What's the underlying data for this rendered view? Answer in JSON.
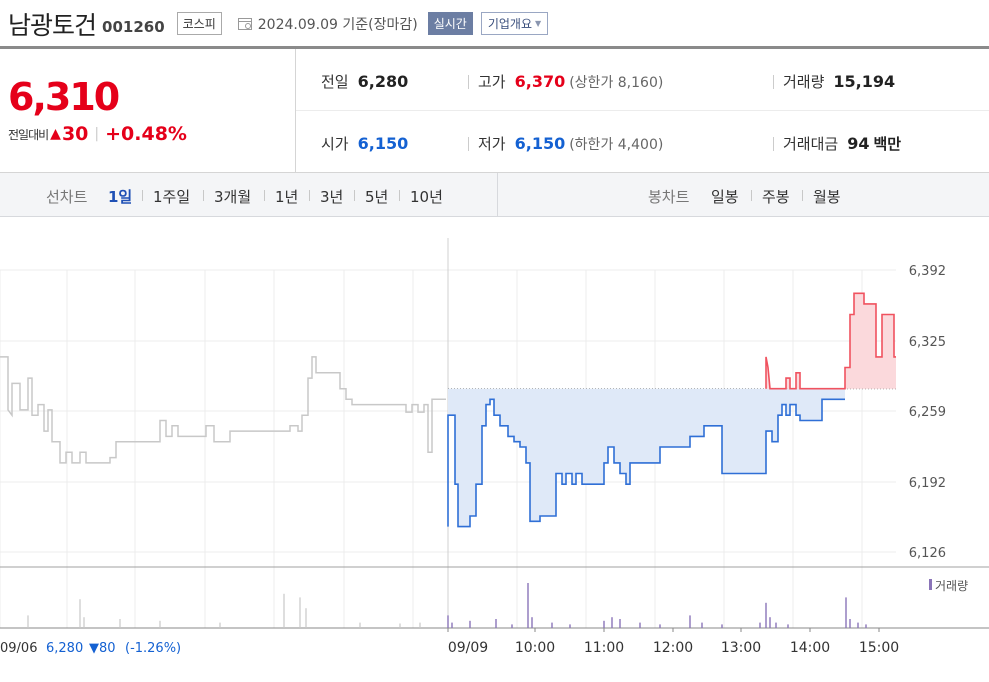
{
  "header": {
    "name": "남광토건",
    "code": "001260",
    "market": "코스피",
    "date_text": "2024.09.09  기준(장마감)",
    "realtime_label": "실시간",
    "company_label": "기업개요"
  },
  "quote": {
    "price": "6,310",
    "change_label": "전일대비",
    "change_value": "30",
    "change_pct": "+0.48%",
    "prev_label": "전일",
    "prev": "6,280",
    "high_label": "고가",
    "high": "6,370",
    "upper_limit": "(상한가 8,160)",
    "volume_label": "거래량",
    "volume": "15,194",
    "open_label": "시가",
    "open": "6,150",
    "low_label": "저가",
    "low": "6,150",
    "lower_limit": "(하한가 4,400)",
    "amount_label": "거래대금",
    "amount": "94",
    "amount_unit": "백만"
  },
  "toolbar": {
    "line_label": "선차트",
    "periods": [
      "1일",
      "1주일",
      "3개월",
      "1년",
      "3년",
      "5년",
      "10년"
    ],
    "candle_label": "봉차트",
    "candles": [
      "일봉",
      "주봉",
      "월봉"
    ]
  },
  "chart_data": {
    "type": "line",
    "yticks": [
      "6,392",
      "6,325",
      "6,259",
      "6,192",
      "6,126"
    ],
    "ylim": [
      6126,
      6392
    ],
    "reference": 6280,
    "xticks": [
      "09/09",
      "10:00",
      "11:00",
      "12:00",
      "13:00",
      "14:00",
      "15:00"
    ],
    "prev_day_label": "09/06",
    "prev_day_close": "6,280",
    "prev_day_change": "▼80",
    "prev_day_pct": "(-1.26%)",
    "volume_legend": "거래량",
    "colors": {
      "up": "#f0525f",
      "down": "#2f6fd6",
      "prev": "#c8c8c8",
      "volume": "#8a74b8"
    },
    "prev_series": [
      [
        0,
        6310
      ],
      [
        8,
        6310
      ],
      [
        8,
        6260
      ],
      [
        12,
        6255
      ],
      [
        12,
        6285
      ],
      [
        20,
        6285
      ],
      [
        20,
        6260
      ],
      [
        28,
        6260
      ],
      [
        28,
        6290
      ],
      [
        32,
        6290
      ],
      [
        32,
        6255
      ],
      [
        38,
        6255
      ],
      [
        38,
        6265
      ],
      [
        44,
        6265
      ],
      [
        44,
        6240
      ],
      [
        48,
        6240
      ],
      [
        48,
        6260
      ],
      [
        52,
        6260
      ],
      [
        52,
        6230
      ],
      [
        60,
        6230
      ],
      [
        60,
        6210
      ],
      [
        66,
        6210
      ],
      [
        66,
        6220
      ],
      [
        72,
        6220
      ],
      [
        72,
        6210
      ],
      [
        80,
        6210
      ],
      [
        80,
        6220
      ],
      [
        86,
        6220
      ],
      [
        86,
        6210
      ],
      [
        110,
        6210
      ],
      [
        110,
        6215
      ],
      [
        116,
        6215
      ],
      [
        116,
        6230
      ],
      [
        160,
        6230
      ],
      [
        160,
        6250
      ],
      [
        166,
        6250
      ],
      [
        166,
        6235
      ],
      [
        172,
        6235
      ],
      [
        172,
        6245
      ],
      [
        178,
        6245
      ],
      [
        178,
        6235
      ],
      [
        206,
        6235
      ],
      [
        206,
        6245
      ],
      [
        214,
        6245
      ],
      [
        214,
        6230
      ],
      [
        230,
        6230
      ],
      [
        230,
        6240
      ],
      [
        290,
        6240
      ],
      [
        290,
        6245
      ],
      [
        298,
        6245
      ],
      [
        298,
        6240
      ],
      [
        302,
        6240
      ],
      [
        302,
        6255
      ],
      [
        308,
        6255
      ],
      [
        308,
        6290
      ],
      [
        312,
        6290
      ],
      [
        312,
        6310
      ],
      [
        316,
        6310
      ],
      [
        316,
        6295
      ],
      [
        340,
        6295
      ],
      [
        340,
        6280
      ],
      [
        346,
        6280
      ],
      [
        346,
        6270
      ],
      [
        352,
        6270
      ],
      [
        352,
        6265
      ],
      [
        406,
        6265
      ],
      [
        406,
        6258
      ],
      [
        412,
        6258
      ],
      [
        412,
        6265
      ],
      [
        418,
        6265
      ],
      [
        418,
        6258
      ],
      [
        424,
        6258
      ],
      [
        424,
        6265
      ],
      [
        428,
        6265
      ],
      [
        428,
        6220
      ],
      [
        432,
        6220
      ],
      [
        432,
        6270
      ],
      [
        446,
        6270
      ]
    ],
    "today_series": [
      [
        448,
        6150
      ],
      [
        448,
        6255
      ],
      [
        455,
        6255
      ],
      [
        455,
        6190
      ],
      [
        458,
        6190
      ],
      [
        458,
        6150
      ],
      [
        470,
        6150
      ],
      [
        470,
        6160
      ],
      [
        476,
        6160
      ],
      [
        476,
        6190
      ],
      [
        482,
        6190
      ],
      [
        482,
        6245
      ],
      [
        486,
        6245
      ],
      [
        486,
        6265
      ],
      [
        490,
        6265
      ],
      [
        490,
        6270
      ],
      [
        494,
        6270
      ],
      [
        494,
        6255
      ],
      [
        500,
        6255
      ],
      [
        500,
        6245
      ],
      [
        508,
        6245
      ],
      [
        508,
        6235
      ],
      [
        514,
        6235
      ],
      [
        514,
        6230
      ],
      [
        520,
        6230
      ],
      [
        520,
        6225
      ],
      [
        526,
        6225
      ],
      [
        526,
        6210
      ],
      [
        530,
        6210
      ],
      [
        530,
        6155
      ],
      [
        540,
        6155
      ],
      [
        540,
        6160
      ],
      [
        556,
        6160
      ],
      [
        556,
        6200
      ],
      [
        562,
        6200
      ],
      [
        562,
        6190
      ],
      [
        566,
        6190
      ],
      [
        566,
        6200
      ],
      [
        572,
        6200
      ],
      [
        572,
        6190
      ],
      [
        576,
        6190
      ],
      [
        576,
        6200
      ],
      [
        582,
        6200
      ],
      [
        582,
        6190
      ],
      [
        604,
        6190
      ],
      [
        604,
        6210
      ],
      [
        608,
        6210
      ],
      [
        608,
        6225
      ],
      [
        614,
        6225
      ],
      [
        614,
        6210
      ],
      [
        620,
        6210
      ],
      [
        620,
        6200
      ],
      [
        626,
        6200
      ],
      [
        626,
        6190
      ],
      [
        630,
        6190
      ],
      [
        630,
        6210
      ],
      [
        660,
        6210
      ],
      [
        660,
        6225
      ],
      [
        690,
        6225
      ],
      [
        690,
        6235
      ],
      [
        704,
        6235
      ],
      [
        704,
        6245
      ],
      [
        722,
        6245
      ],
      [
        722,
        6200
      ],
      [
        766,
        6200
      ],
      [
        766,
        6240
      ],
      [
        772,
        6240
      ],
      [
        772,
        6230
      ],
      [
        778,
        6230
      ],
      [
        778,
        6255
      ],
      [
        782,
        6255
      ],
      [
        782,
        6265
      ],
      [
        786,
        6265
      ],
      [
        786,
        6255
      ],
      [
        790,
        6255
      ],
      [
        790,
        6265
      ],
      [
        796,
        6265
      ],
      [
        796,
        6255
      ],
      [
        800,
        6255
      ],
      [
        800,
        6250
      ],
      [
        822,
        6250
      ],
      [
        822,
        6270
      ],
      [
        845,
        6270
      ]
    ],
    "up_series": [
      [
        766,
        6280
      ],
      [
        766,
        6310
      ],
      [
        768,
        6300
      ],
      [
        770,
        6280
      ],
      [
        786,
        6280
      ],
      [
        786,
        6290
      ],
      [
        790,
        6290
      ],
      [
        790,
        6280
      ],
      [
        796,
        6280
      ],
      [
        796,
        6295
      ],
      [
        800,
        6295
      ],
      [
        800,
        6280
      ],
      [
        845,
        6280
      ],
      [
        845,
        6300
      ],
      [
        850,
        6300
      ],
      [
        850,
        6350
      ],
      [
        854,
        6350
      ],
      [
        854,
        6370
      ],
      [
        864,
        6370
      ],
      [
        864,
        6360
      ],
      [
        876,
        6360
      ],
      [
        876,
        6310
      ],
      [
        882,
        6310
      ],
      [
        882,
        6350
      ],
      [
        894,
        6350
      ],
      [
        894,
        6310
      ],
      [
        896,
        6310
      ]
    ],
    "prev_volume": [
      [
        28,
        14
      ],
      [
        80,
        32
      ],
      [
        84,
        12
      ],
      [
        120,
        10
      ],
      [
        160,
        8
      ],
      [
        220,
        6
      ],
      [
        284,
        38
      ],
      [
        300,
        34
      ],
      [
        306,
        22
      ],
      [
        360,
        6
      ],
      [
        400,
        5
      ],
      [
        420,
        6
      ]
    ],
    "today_volume": [
      [
        448,
        14
      ],
      [
        452,
        6
      ],
      [
        470,
        8
      ],
      [
        496,
        10
      ],
      [
        512,
        4
      ],
      [
        528,
        50
      ],
      [
        532,
        12
      ],
      [
        552,
        6
      ],
      [
        570,
        4
      ],
      [
        604,
        8
      ],
      [
        612,
        12
      ],
      [
        620,
        10
      ],
      [
        640,
        6
      ],
      [
        660,
        4
      ],
      [
        690,
        14
      ],
      [
        702,
        6
      ],
      [
        722,
        4
      ],
      [
        760,
        6
      ],
      [
        766,
        28
      ],
      [
        770,
        12
      ],
      [
        776,
        6
      ],
      [
        788,
        4
      ],
      [
        846,
        34
      ],
      [
        850,
        10
      ],
      [
        858,
        6
      ],
      [
        866,
        4
      ]
    ]
  }
}
